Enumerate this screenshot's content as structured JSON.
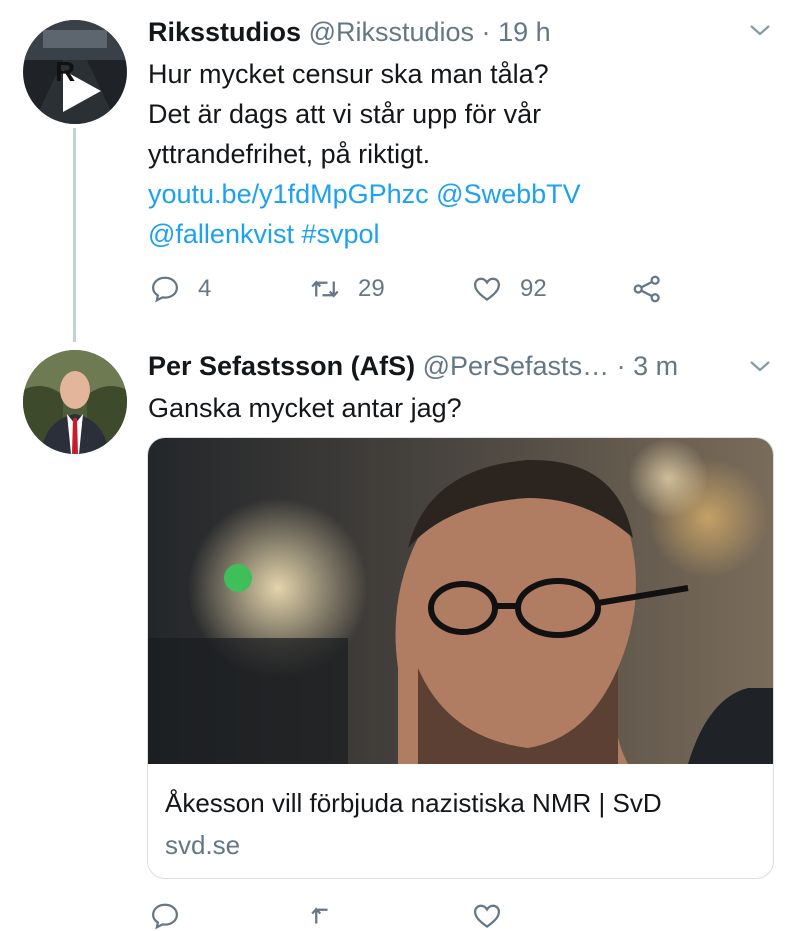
{
  "tweet1": {
    "display_name": "Riksstudios",
    "handle": "@Riksstudios",
    "separator": "·",
    "time": "19 h",
    "text_lines": [
      "Hur mycket censur ska man tåla?",
      "Det är dags att vi står upp för vår",
      "yttrandefrihet, på riktigt."
    ],
    "link_url": "youtu.be/y1fdMpGPhzc",
    "mention1": "@SwebbTV",
    "mention2": "@fallenkvist",
    "hashtag": "#svpol",
    "avatar_letter": "R",
    "replies": "4",
    "retweets": "29",
    "likes": "92"
  },
  "tweet2": {
    "display_name": "Per Sefastsson (AfS)",
    "handle": "@PerSefasts…",
    "separator": "·",
    "time": "3 m",
    "text": "Ganska mycket antar jag?",
    "card": {
      "title": "Åkesson vill förbjuda nazistiska NMR | SvD",
      "domain": "svd.se"
    }
  },
  "icons": {
    "reply": "reply-icon",
    "retweet": "retweet-icon",
    "like": "heart-icon",
    "share": "share-icon",
    "chevron": "chevron-down-icon"
  },
  "colors": {
    "link": "#1da1f2",
    "secondary_text": "#657786",
    "thread_line": "#c4cfd6"
  }
}
